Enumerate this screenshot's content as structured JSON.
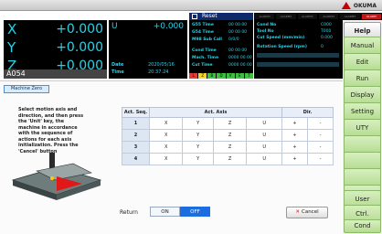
{
  "brand": "OKUMA",
  "axes": [
    {
      "label": "X",
      "value": "+0.000"
    },
    {
      "label": "Y",
      "value": "+0.000"
    },
    {
      "label": "Z",
      "value": "+0.000"
    }
  ],
  "u_axis": {
    "label": "U",
    "value": "+0.000"
  },
  "program_name": "A054",
  "date_label": "Date",
  "date_value": "2020/05/16",
  "time_label": "Time",
  "time_value": "20:37:24",
  "status_title": "Reset",
  "alarm_items": [
    "ALARM1",
    "ALARM2",
    "ALARM3",
    "ALARM4",
    "ALARM5",
    "ALARM"
  ],
  "times": [
    {
      "label": "G55 Time",
      "value": "00 00 00"
    },
    {
      "label": "G54 Time",
      "value": "00 00 00"
    },
    {
      "label": "M98 Sub Call",
      "value": "0/0/0"
    },
    {
      "label": "Cond Time",
      "value": "00 00 00"
    },
    {
      "label": "Mach. Time",
      "value": "0000 00 00"
    },
    {
      "label": "Cut Time",
      "value": "0000 00 00"
    }
  ],
  "conditions": [
    {
      "label": "Cond No",
      "value": "C000"
    },
    {
      "label": "Tool No",
      "value": "T000"
    },
    {
      "label": "Cut Speed (mm/min)",
      "value": "0.000"
    },
    {
      "label": "Rotation Speed (rpm)",
      "value": "0"
    }
  ],
  "leds": [
    "L",
    "Z",
    "B",
    "D",
    "V",
    "E",
    "T"
  ],
  "rail_buttons": [
    "Help",
    "Manual",
    "Edit",
    "Run",
    "Display",
    "Setting",
    "UTY",
    "",
    "",
    "",
    "",
    "User",
    "Ctrl.",
    "Cond"
  ],
  "panel": {
    "mode_label": "Machine Zero",
    "instructions": "Select motion axis and direction, and then press the 'Unit' key, the machine in accordance with the sequence of actions for each axis initialization. Press the 'Cancel' button",
    "table_headers": {
      "seq": "Act. Seq.",
      "axis": "Act. Axis",
      "dir": "Dir."
    },
    "rows": [
      {
        "seq": "1",
        "cells": [
          "X",
          "Y",
          "Z",
          "U",
          "+",
          "-"
        ]
      },
      {
        "seq": "2",
        "cells": [
          "X",
          "Y",
          "Z",
          "U",
          "+",
          "-"
        ]
      },
      {
        "seq": "3",
        "cells": [
          "X",
          "Y",
          "Z",
          "U",
          "+",
          "-"
        ]
      },
      {
        "seq": "4",
        "cells": [
          "X",
          "Y",
          "Z",
          "U",
          "+",
          "-"
        ]
      }
    ],
    "return_label": "Return",
    "on_label": "ON",
    "off_label": "OFF",
    "cancel_label": "Cancel"
  }
}
